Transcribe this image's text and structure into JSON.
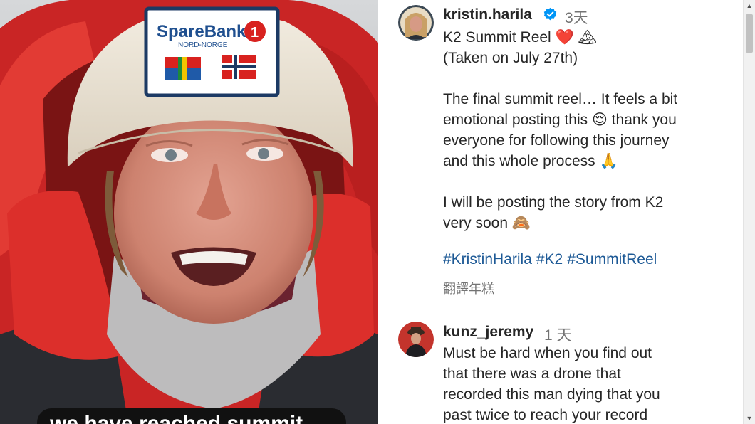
{
  "post": {
    "username": "kristin.harila",
    "time": "3天",
    "caption_lines": [
      "K2 Summit Reel ❤️ 🏔",
      "(Taken on July 27th)",
      "",
      "The final summit reel… It feels a bit",
      "emotional posting this 😌 thank you",
      "everyone for following this journey",
      "and this whole process 🙏",
      "",
      "I will be posting the story from K2",
      "very soon 🙈"
    ],
    "hashtags": [
      "#KristinHarila",
      "#K2",
      "#SummitReel"
    ],
    "translate_label": "翻譯年糕"
  },
  "comment": {
    "username": "kunz_jeremy",
    "time": "1 天",
    "text_lines": [
      "Must be hard when you find out",
      "that there was a drone that",
      "recorded this man dying that you",
      "past twice to reach your record"
    ]
  },
  "media": {
    "subtitle": "we have reached summit",
    "hat_patch_brand": "SpareBank",
    "hat_patch_region": "NORD-NORGE",
    "hat_patch_number": "1"
  },
  "colors": {
    "link": "#1e5a96",
    "verified": "#0095f6",
    "jacket": "#d42a2a"
  },
  "icons": {
    "verified": "verified-badge-icon",
    "scroll_up": "arrow-up-icon",
    "scroll_down": "arrow-down-icon"
  }
}
